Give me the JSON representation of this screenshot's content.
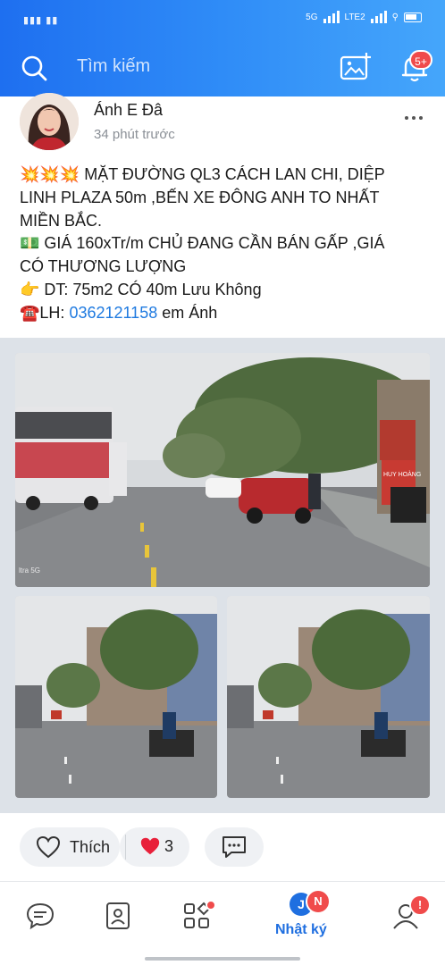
{
  "colors": {
    "accent": "#1f6fe0",
    "badge": "#f04b4b",
    "heart": "#e8203a"
  },
  "status_bar": {
    "network": "5G",
    "network2": "LTE2"
  },
  "header": {
    "search_placeholder": "Tìm kiếm",
    "notification_badge": "5+"
  },
  "post": {
    "author": "Ánh E Đâ",
    "time": "34 phút trước",
    "lines": [
      "💥💥💥 MẶT ĐƯỜNG QL3 CÁCH LAN CHI, DIỆP",
      "LINH PLAZA 50m ,BẾN XE ĐÔNG ANH TO NHẤT",
      "MIỀN BẮC.",
      "💵 GIÁ 160xTr/m CHỦ ĐANG CẦN BÁN GẤP ,GIÁ",
      "CÓ THƯƠNG LƯỢNG",
      "👉 DT: 75m2 CÓ 40m Lưu Không"
    ],
    "contact_prefix": "☎️LH: ",
    "phone": "0362121158",
    "contact_suffix": " em Ánh",
    "photo_watermark": "ltra 5G",
    "sign_text": "HUY HOÀNG"
  },
  "reactions": {
    "like_label": "Thích",
    "count": "3"
  },
  "bottom_nav": {
    "items": [
      {
        "name": "messages",
        "icon": "chat-icon"
      },
      {
        "name": "contacts",
        "icon": "contact-icon"
      },
      {
        "name": "discover",
        "icon": "grid-icon"
      },
      {
        "name": "diary",
        "icon": "diary-icon",
        "label": "Nhật ký",
        "avatar_letter": "J",
        "badge": "N"
      },
      {
        "name": "profile",
        "icon": "person-icon",
        "badge": "!"
      }
    ]
  }
}
